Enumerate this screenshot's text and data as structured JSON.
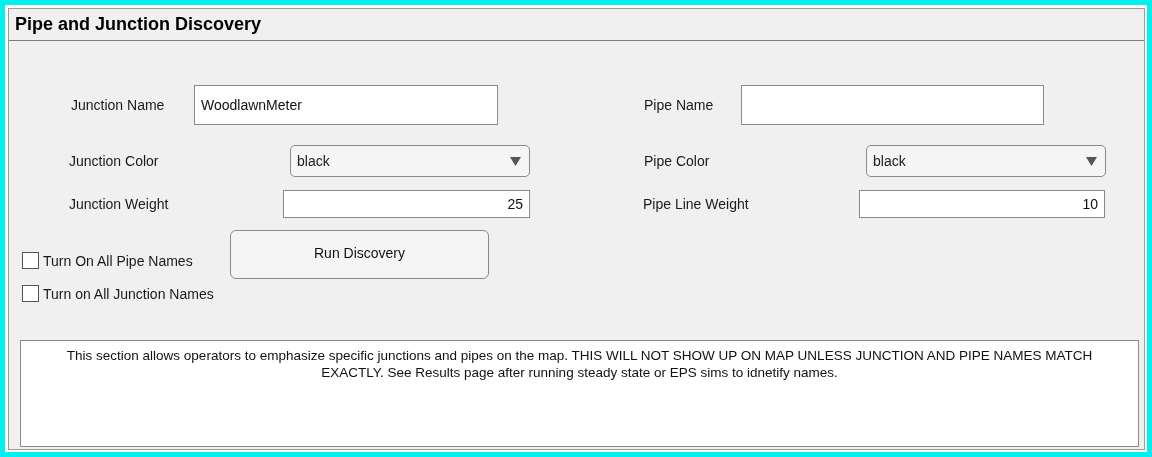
{
  "title": "Pipe and Junction Discovery",
  "junction": {
    "name_label": "Junction Name",
    "name_value": "WoodlawnMeter",
    "color_label": "Junction Color",
    "color_value": "black",
    "weight_label": "Junction Weight",
    "weight_value": "25"
  },
  "pipe": {
    "name_label": "Pipe Name",
    "color_label": "Pipe Color",
    "color_value": "black",
    "weight_label": "Pipe Line Weight",
    "weight_value": "10"
  },
  "checkboxes": [
    {
      "label": "Turn On All Pipe Names",
      "checked": false
    },
    {
      "label": "Turn on All Junction Names",
      "checked": false
    }
  ],
  "button": "Run Discovery",
  "note": "This section allows operators to emphasize specific junctions and pipes on the map. THIS WILL NOT SHOW UP ON MAP UNLESS JUNCTION AND PIPE NAMES MATCH EXACTLY. See Results page after running steady state or EPS sims to idnetify names."
}
